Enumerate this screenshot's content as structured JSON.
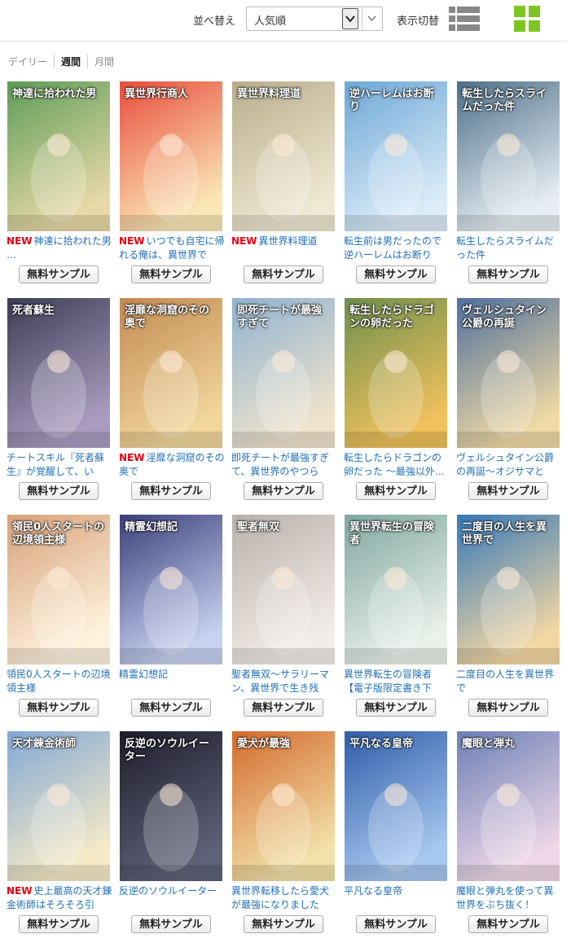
{
  "header": {
    "sort_label": "並べ替え",
    "sort_value": "人気順",
    "view_label": "表示切替",
    "list_view_icon": "list-view-icon",
    "grid_view_icon": "grid-view-icon",
    "active_color": "#7dc523",
    "inactive_color": "#888888"
  },
  "periods": [
    "デイリー",
    "週間",
    "月間"
  ],
  "active_period": "週間",
  "button_label": "無料サンプル",
  "new_badge": "NEW",
  "books": [
    {
      "new": true,
      "title": "神達に拾われた男 …",
      "colors": [
        "#5d9c58",
        "#e8d9a6"
      ],
      "cover_text": "神達に拾われた男"
    },
    {
      "new": true,
      "title": "いつでも自宅に帰れる俺は、異世界で行…",
      "colors": [
        "#e84d3c",
        "#fbe7b5"
      ],
      "cover_text": "異世界行商人"
    },
    {
      "new": true,
      "title": "異世界料理道",
      "colors": [
        "#b9ad8b",
        "#efe8d2"
      ],
      "cover_text": "異世界料理道"
    },
    {
      "new": false,
      "title": "転生前は男だったので逆ハーレムはお断りし…",
      "colors": [
        "#6da7d6",
        "#dbecf8"
      ],
      "cover_text": "逆ハーレムはお断り"
    },
    {
      "new": false,
      "title": "転生したらスライムだった件",
      "colors": [
        "#4d6f88",
        "#e6eef3"
      ],
      "cover_text": "転生したらスライムだった件"
    },
    {
      "new": false,
      "title": "チートスキル『死者蘇生』が覚醒して、いに…",
      "colors": [
        "#3d3d54",
        "#a99cc0"
      ],
      "cover_text": "死者蘇生"
    },
    {
      "new": true,
      "title": "淫靡な洞窟のその奥で",
      "colors": [
        "#c08a52",
        "#f2d69b"
      ],
      "cover_text": "淫靡な洞窟のその奥で"
    },
    {
      "new": false,
      "title": "即死チートが最強すぎて、異世界のやつらが…",
      "colors": [
        "#8fb2d0",
        "#efe3cc"
      ],
      "cover_text": "即死チートが最強すぎて"
    },
    {
      "new": false,
      "title": "転生したらドラゴンの卵だった ～最強以外…",
      "colors": [
        "#6e8f4d",
        "#f1c15c"
      ],
      "cover_text": "転生したらドラゴンの卵だった"
    },
    {
      "new": false,
      "title": "ヴェルシュタイン公爵の再誕～オジサマとか…",
      "colors": [
        "#4f6f9c",
        "#efd9a4"
      ],
      "cover_text": "ヴェルシュタイン公爵の再誕"
    },
    {
      "new": false,
      "title": "領民0人スタートの辺境領主様",
      "colors": [
        "#d7a27a",
        "#fff3dd"
      ],
      "cover_text": "領民0人スタートの辺境領主様"
    },
    {
      "new": false,
      "title": "精霊幻想記",
      "colors": [
        "#3b3f7a",
        "#c7d2f0"
      ],
      "cover_text": "精霊幻想記"
    },
    {
      "new": false,
      "title": "聖者無双～サラリーマン、異世界で生き残る…",
      "colors": [
        "#b8b0ab",
        "#f3ede8"
      ],
      "cover_text": "聖者無双"
    },
    {
      "new": false,
      "title": "異世界転生の冒険者 【電子版限定書き下ろ…",
      "colors": [
        "#7fa7a0",
        "#e9f1ea"
      ],
      "cover_text": "異世界転生の冒険者"
    },
    {
      "new": false,
      "title": "二度目の人生を異世界で",
      "colors": [
        "#3578b8",
        "#f4d7a2"
      ],
      "cover_text": "二度目の人生を異世界で"
    },
    {
      "new": true,
      "title": "史上最高の天才錬金術師はそろそろ引退…",
      "colors": [
        "#82a8d6",
        "#f6eac6"
      ],
      "cover_text": "天才錬金術師"
    },
    {
      "new": false,
      "title": "反逆のソウルイーター",
      "colors": [
        "#1d1d2b",
        "#5f6178"
      ],
      "cover_text": "反逆のソウルイーター"
    },
    {
      "new": false,
      "title": "異世界転移したら愛犬が最強になりました～…",
      "colors": [
        "#d36a2c",
        "#f3e2a9"
      ],
      "cover_text": "愛犬が最強"
    },
    {
      "new": false,
      "title": "平凡なる皇帝",
      "colors": [
        "#2f5da8",
        "#a7c8f0"
      ],
      "cover_text": "平凡なる皇帝"
    },
    {
      "new": false,
      "title": "魔眼と弾丸を使って異世界をぶち抜く！",
      "colors": [
        "#6b7fb5",
        "#f0d8e8"
      ],
      "cover_text": "魔眼と弾丸"
    }
  ]
}
